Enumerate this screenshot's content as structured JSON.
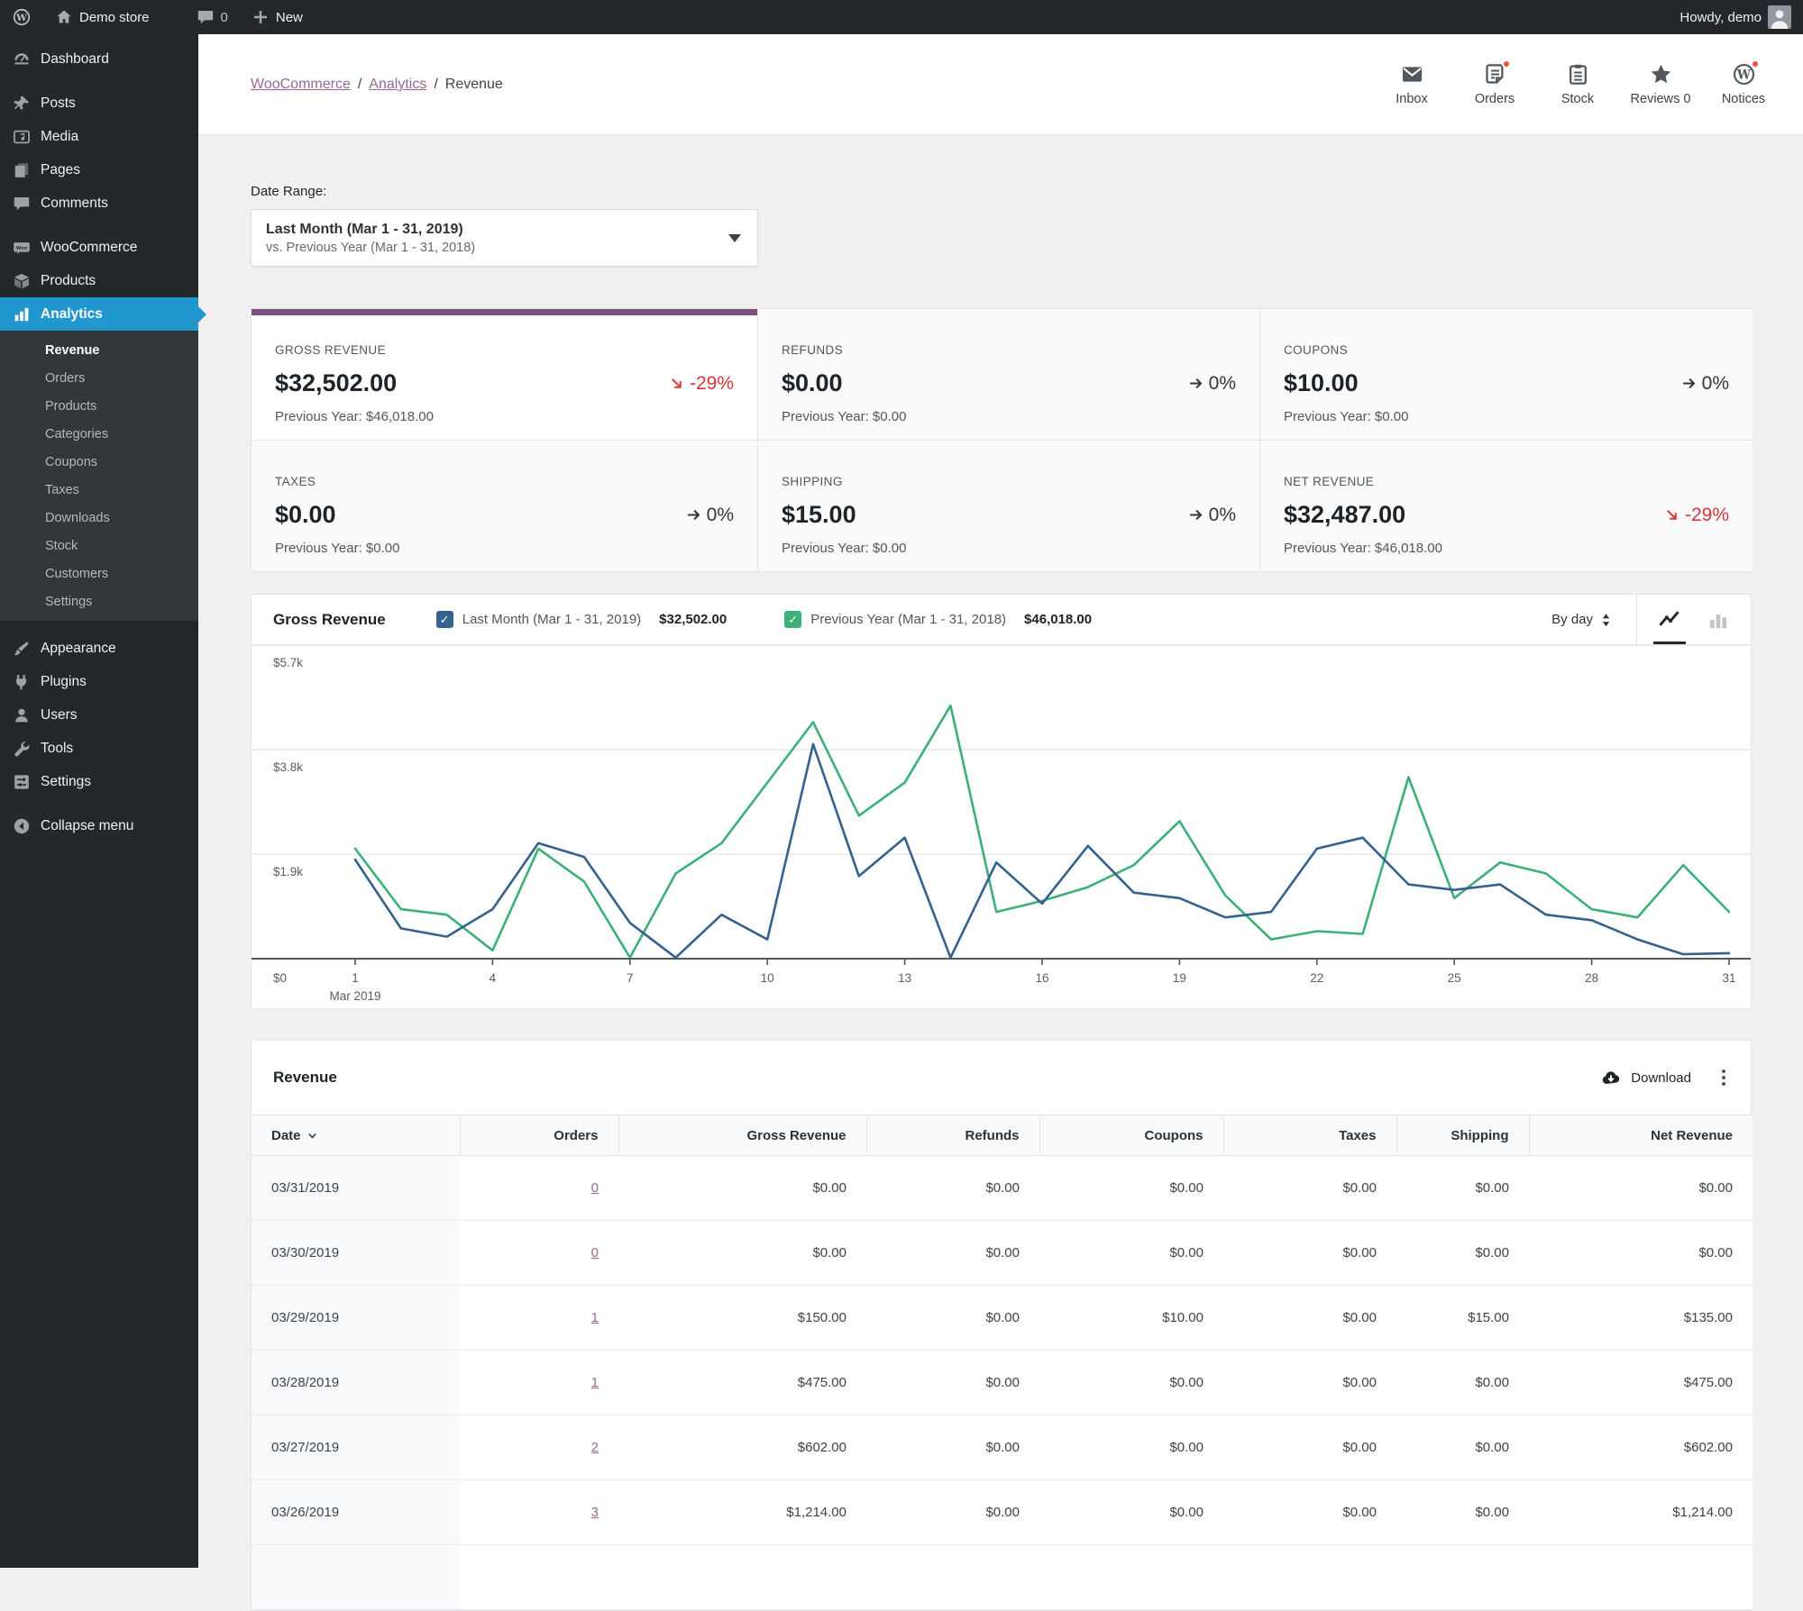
{
  "admin_bar": {
    "site_name": "Demo store",
    "comments_count": "0",
    "new_label": "New",
    "howdy": "Howdy, demo"
  },
  "sidebar": {
    "items": [
      {
        "label": "Dashboard",
        "icon": "dashboard-icon"
      },
      {
        "label": "Posts",
        "icon": "pin-icon"
      },
      {
        "label": "Media",
        "icon": "media-icon"
      },
      {
        "label": "Pages",
        "icon": "pages-icon"
      },
      {
        "label": "Comments",
        "icon": "comments-icon"
      },
      {
        "label": "WooCommerce",
        "icon": "woocommerce-icon"
      },
      {
        "label": "Products",
        "icon": "products-icon"
      },
      {
        "label": "Analytics",
        "icon": "analytics-icon",
        "active": true
      }
    ],
    "analytics_submenu": [
      "Revenue",
      "Orders",
      "Products",
      "Categories",
      "Coupons",
      "Taxes",
      "Downloads",
      "Stock",
      "Customers",
      "Settings"
    ],
    "submenu_current": "Revenue",
    "secondary_items": [
      {
        "label": "Appearance",
        "icon": "appearance-icon"
      },
      {
        "label": "Plugins",
        "icon": "plugins-icon"
      },
      {
        "label": "Users",
        "icon": "users-icon"
      },
      {
        "label": "Tools",
        "icon": "tools-icon"
      },
      {
        "label": "Settings",
        "icon": "settings-icon"
      }
    ],
    "collapse": {
      "label": "Collapse menu",
      "icon": "collapse-icon"
    }
  },
  "header": {
    "breadcrumb": [
      {
        "label": "WooCommerce",
        "link": true
      },
      {
        "label": "Analytics",
        "link": true
      },
      {
        "label": "Revenue",
        "link": false
      }
    ],
    "activity": [
      {
        "label": "Inbox",
        "icon": "inbox-icon",
        "badge": false
      },
      {
        "label": "Orders",
        "icon": "orders-icon",
        "badge": true
      },
      {
        "label": "Stock",
        "icon": "stock-icon",
        "badge": false
      },
      {
        "label": "Reviews 0",
        "icon": "star-icon",
        "badge": false
      },
      {
        "label": "Notices",
        "icon": "wordpress-icon",
        "badge": true
      }
    ]
  },
  "date_range": {
    "label": "Date Range:",
    "primary": "Last Month (Mar 1 - 31, 2019)",
    "secondary": "vs. Previous Year (Mar 1 - 31, 2018)"
  },
  "summary_cards": [
    {
      "label": "GROSS REVENUE",
      "value": "$32,502.00",
      "change": "-29%",
      "direction": "down",
      "prev": "Previous Year: $46,018.00",
      "selected": true
    },
    {
      "label": "REFUNDS",
      "value": "$0.00",
      "change": "0%",
      "direction": "flat",
      "prev": "Previous Year: $0.00",
      "selected": false
    },
    {
      "label": "COUPONS",
      "value": "$10.00",
      "change": "0%",
      "direction": "flat",
      "prev": "Previous Year: $0.00",
      "selected": false
    },
    {
      "label": "TAXES",
      "value": "$0.00",
      "change": "0%",
      "direction": "flat",
      "prev": "Previous Year: $0.00",
      "selected": false
    },
    {
      "label": "SHIPPING",
      "value": "$15.00",
      "change": "0%",
      "direction": "flat",
      "prev": "Previous Year: $0.00",
      "selected": false
    },
    {
      "label": "NET REVENUE",
      "value": "$32,487.00",
      "change": "-29%",
      "direction": "down",
      "prev": "Previous Year: $46,018.00",
      "selected": false
    }
  ],
  "chart": {
    "title": "Gross Revenue",
    "interval_label": "By day"
  },
  "chart_data": {
    "type": "line",
    "title": "Gross Revenue",
    "x": [
      1,
      2,
      3,
      4,
      5,
      6,
      7,
      8,
      9,
      10,
      11,
      12,
      13,
      14,
      15,
      16,
      17,
      18,
      19,
      20,
      21,
      22,
      23,
      24,
      25,
      26,
      27,
      28,
      29,
      30,
      31
    ],
    "xticks": [
      1,
      4,
      7,
      10,
      13,
      16,
      19,
      22,
      25,
      28,
      31
    ],
    "x_axis_secondary_label": "Mar 2019",
    "yticks": [
      {
        "label": "$0",
        "value": 0
      },
      {
        "label": "$1.9k",
        "value": 1900
      },
      {
        "label": "$3.8k",
        "value": 3800
      },
      {
        "label": "$5.7k",
        "value": 5700
      }
    ],
    "ylim": [
      0,
      5700
    ],
    "grid": "horizontal",
    "legend_position": "top",
    "series": [
      {
        "name": "Last Month (Mar 1 - 31, 2019)",
        "total": "$32,502.00",
        "color": "#34618e",
        "values": [
          1800,
          550,
          400,
          900,
          2100,
          1850,
          650,
          20,
          800,
          350,
          3900,
          1500,
          2200,
          20,
          1750,
          1000,
          2050,
          1200,
          1100,
          750,
          850,
          2000,
          2200,
          1350,
          1250,
          1350,
          800,
          700,
          350,
          80,
          100
        ]
      },
      {
        "name": "Previous Year (Mar 1 - 31, 2018)",
        "total": "$46,018.00",
        "color": "#3bb077",
        "values": [
          2000,
          900,
          800,
          150,
          2000,
          1400,
          20,
          1550,
          2100,
          3200,
          4300,
          2600,
          3200,
          4600,
          850,
          1050,
          1300,
          1700,
          2500,
          1150,
          350,
          500,
          450,
          3300,
          1100,
          1750,
          1550,
          900,
          750,
          1700,
          850
        ]
      }
    ]
  },
  "table": {
    "title": "Revenue",
    "download_label": "Download",
    "columns": [
      "Date",
      "Orders",
      "Gross Revenue",
      "Refunds",
      "Coupons",
      "Taxes",
      "Shipping",
      "Net Revenue"
    ],
    "sorted_column": "Date",
    "rows": [
      [
        "03/31/2019",
        "0",
        "$0.00",
        "$0.00",
        "$0.00",
        "$0.00",
        "$0.00",
        "$0.00"
      ],
      [
        "03/30/2019",
        "0",
        "$0.00",
        "$0.00",
        "$0.00",
        "$0.00",
        "$0.00",
        "$0.00"
      ],
      [
        "03/29/2019",
        "1",
        "$150.00",
        "$0.00",
        "$10.00",
        "$0.00",
        "$15.00",
        "$135.00"
      ],
      [
        "03/28/2019",
        "1",
        "$475.00",
        "$0.00",
        "$0.00",
        "$0.00",
        "$0.00",
        "$475.00"
      ],
      [
        "03/27/2019",
        "2",
        "$602.00",
        "$0.00",
        "$0.00",
        "$0.00",
        "$0.00",
        "$602.00"
      ],
      [
        "03/26/2019",
        "3",
        "$1,214.00",
        "$0.00",
        "$0.00",
        "$0.00",
        "$0.00",
        "$1,214.00"
      ]
    ]
  },
  "colors": {
    "accent_purple": "#7d517c",
    "link_purple": "#9a6794",
    "menu_active_blue": "#2196cf",
    "badge_orange": "#e8563e",
    "negative_red": "#d63638",
    "series_blue": "#34618e",
    "series_green": "#3bb077",
    "gridline": "#e7e8ea",
    "axis": "#50575e"
  }
}
